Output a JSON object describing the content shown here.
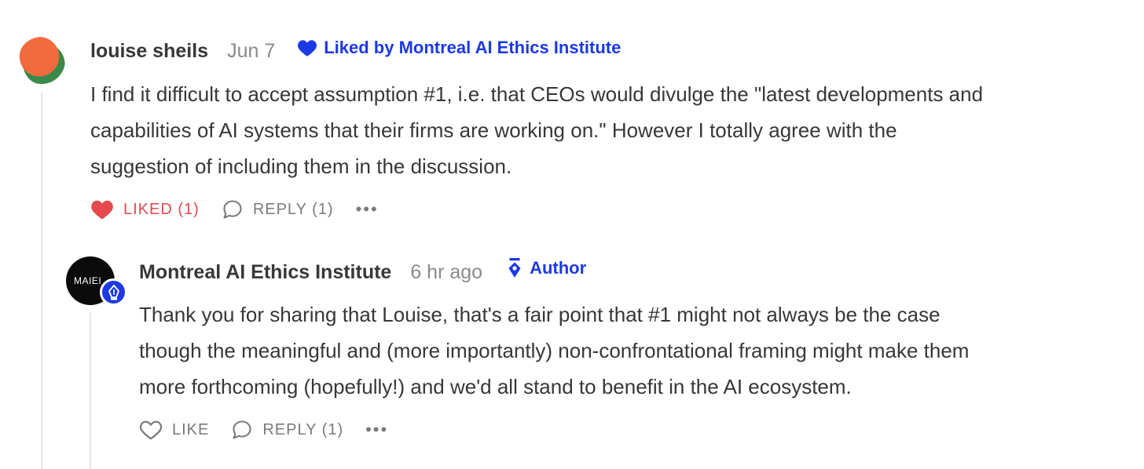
{
  "comment": {
    "author": "louise sheils",
    "date": "Jun 7",
    "liked_by": "Liked by Montreal AI Ethics Institute",
    "body_lines": [
      "I find it difficult to accept assumption #1, i.e. that CEOs would divulge the \"latest developments and",
      "capabilities of AI systems that their firms are working on.\" However I totally agree with the",
      "suggestion of including them in the discussion."
    ],
    "like_label": "LIKED (1)",
    "reply_label": "REPLY (1)",
    "more_label": "•••"
  },
  "reply": {
    "author": "Montreal AI Ethics Institute",
    "avatar_text": "MAIEI",
    "date": "6 hr ago",
    "badge": "Author",
    "body_lines": [
      "Thank you for sharing that Louise, that's a fair point that #1 might not always be the case",
      "though the meaningful and (more importantly) non-confrontational framing might make them",
      "more forthcoming (hopefully!) and we'd all stand to benefit in the AI ecosystem."
    ],
    "like_label": "LIKE",
    "reply_label": "REPLY (1)",
    "more_label": "•••"
  },
  "colors": {
    "accent": "#1c39e6",
    "liked": "#e5484d",
    "text": "#363737",
    "muted": "#8a8a8a"
  }
}
